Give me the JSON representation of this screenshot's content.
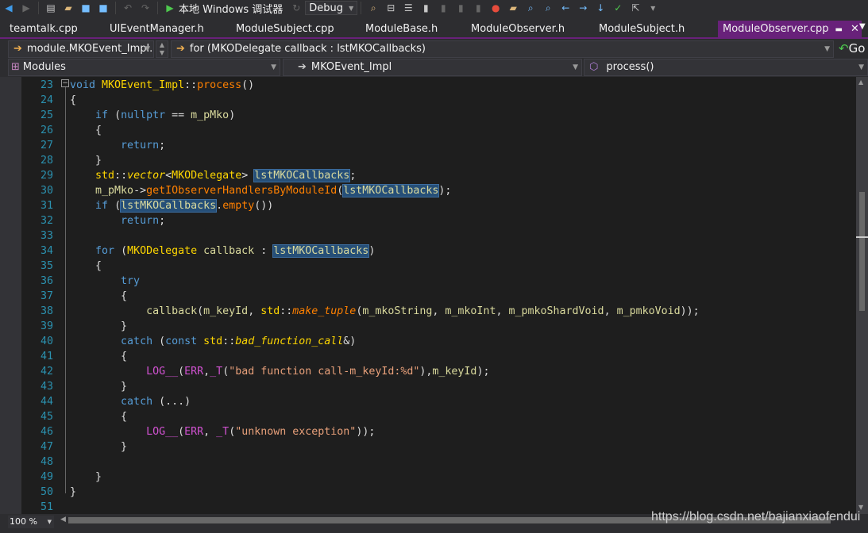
{
  "toolbar": {
    "run_label": "本地 Windows 调试器",
    "config": "Debug"
  },
  "tabs": [
    {
      "label": "teamtalk.cpp"
    },
    {
      "label": "UIEventManager.h"
    },
    {
      "label": "ModuleSubject.cpp"
    },
    {
      "label": "ModuleBase.h"
    },
    {
      "label": "ModuleObserver.h"
    },
    {
      "label": "ModuleSubject.h"
    },
    {
      "label": "ModuleObserver.cpp",
      "active": true
    }
  ],
  "nav": {
    "scope": "module.MKOEvent_Impl.",
    "statement": "for (MKODelegate callback : lstMKOCallbacks)",
    "go": "Go",
    "project": "Modules",
    "class": "MKOEvent_Impl",
    "member": "process()"
  },
  "colors": {
    "accent": "#68217a",
    "keyword": "#569cd6",
    "highlight": "#264f78",
    "line_number": "#2b91af"
  },
  "lines": [
    {
      "n": "23",
      "t": [
        [
          "kw",
          "void "
        ],
        [
          "type",
          "MKOEvent_Impl"
        ],
        [
          "pl",
          "::"
        ],
        [
          "fn",
          "process"
        ],
        [
          "pl",
          "()"
        ]
      ]
    },
    {
      "n": "24",
      "t": [
        [
          "pl",
          "{"
        ]
      ]
    },
    {
      "n": "25",
      "t": [
        [
          "pl",
          "    "
        ],
        [
          "kw",
          "if "
        ],
        [
          "pl",
          "("
        ],
        [
          "kw",
          "nullptr"
        ],
        [
          "pl",
          " == "
        ],
        [
          "mem",
          "m_pMko"
        ],
        [
          "pl",
          ")"
        ]
      ]
    },
    {
      "n": "26",
      "t": [
        [
          "pl",
          "    {"
        ]
      ]
    },
    {
      "n": "27",
      "t": [
        [
          "pl",
          "        "
        ],
        [
          "kw",
          "return"
        ],
        [
          "pl",
          ";"
        ]
      ]
    },
    {
      "n": "28",
      "t": [
        [
          "pl",
          "    }"
        ]
      ]
    },
    {
      "n": "29",
      "t": [
        [
          "pl",
          "    "
        ],
        [
          "type",
          "std"
        ],
        [
          "pl",
          "::"
        ],
        [
          "ty2",
          "vector"
        ],
        [
          "pl",
          "<"
        ],
        [
          "type",
          "MKODelegate"
        ],
        [
          "pl",
          "> "
        ],
        [
          "hl",
          "lstMKOCallbacks"
        ],
        [
          "pl",
          ";"
        ]
      ]
    },
    {
      "n": "30",
      "t": [
        [
          "pl",
          "    "
        ],
        [
          "mem",
          "m_pMko"
        ],
        [
          "pl",
          "->"
        ],
        [
          "fn",
          "getIObserverHandlersByModuleId"
        ],
        [
          "pl",
          "("
        ],
        [
          "hl",
          "lstMKOCallbacks"
        ],
        [
          "pl",
          ");"
        ]
      ]
    },
    {
      "n": "31",
      "t": [
        [
          "pl",
          "    "
        ],
        [
          "kw",
          "if "
        ],
        [
          "pl",
          "("
        ],
        [
          "hl",
          "lstMKOCallbacks"
        ],
        [
          "pl",
          "."
        ],
        [
          "fn",
          "empty"
        ],
        [
          "pl",
          "())"
        ]
      ]
    },
    {
      "n": "32",
      "t": [
        [
          "pl",
          "        "
        ],
        [
          "kw",
          "return"
        ],
        [
          "pl",
          ";"
        ]
      ]
    },
    {
      "n": "33",
      "t": []
    },
    {
      "n": "34",
      "t": [
        [
          "pl",
          "    "
        ],
        [
          "kw",
          "for "
        ],
        [
          "pl",
          "("
        ],
        [
          "type",
          "MKODelegate"
        ],
        [
          "var",
          " callback"
        ],
        [
          "pl",
          " : "
        ],
        [
          "hl",
          "lstMKOCallbacks"
        ],
        [
          "pl",
          ")"
        ]
      ]
    },
    {
      "n": "35",
      "t": [
        [
          "pl",
          "    {"
        ]
      ]
    },
    {
      "n": "36",
      "t": [
        [
          "pl",
          "        "
        ],
        [
          "kw",
          "try"
        ]
      ]
    },
    {
      "n": "37",
      "t": [
        [
          "pl",
          "        {"
        ]
      ]
    },
    {
      "n": "38",
      "t": [
        [
          "pl",
          "            "
        ],
        [
          "var",
          "callback"
        ],
        [
          "pl",
          "("
        ],
        [
          "mem",
          "m_keyId"
        ],
        [
          "pl",
          ", "
        ],
        [
          "type",
          "std"
        ],
        [
          "pl",
          "::"
        ],
        [
          "fni",
          "make_tuple"
        ],
        [
          "pl",
          "("
        ],
        [
          "mem",
          "m_mkoString"
        ],
        [
          "pl",
          ", "
        ],
        [
          "mem",
          "m_mkoInt"
        ],
        [
          "pl",
          ", "
        ],
        [
          "mem",
          "m_pmkoShardVoid"
        ],
        [
          "pl",
          ", "
        ],
        [
          "mem",
          "m_pmkoVoid"
        ],
        [
          "pl",
          "));"
        ]
      ]
    },
    {
      "n": "39",
      "t": [
        [
          "pl",
          "        }"
        ]
      ]
    },
    {
      "n": "40",
      "t": [
        [
          "pl",
          "        "
        ],
        [
          "kw",
          "catch "
        ],
        [
          "pl",
          "("
        ],
        [
          "kw",
          "const "
        ],
        [
          "type",
          "std"
        ],
        [
          "pl",
          "::"
        ],
        [
          "ty2",
          "bad_function_call"
        ],
        [
          "pl",
          "&)"
        ]
      ]
    },
    {
      "n": "41",
      "t": [
        [
          "pl",
          "        {"
        ]
      ]
    },
    {
      "n": "42",
      "t": [
        [
          "pl",
          "            "
        ],
        [
          "mac",
          "LOG__"
        ],
        [
          "pl",
          "("
        ],
        [
          "mac",
          "ERR"
        ],
        [
          "pl",
          ","
        ],
        [
          "mac",
          "_T"
        ],
        [
          "pl",
          "("
        ],
        [
          "str",
          "\"bad function call-m_keyId:%d\""
        ],
        [
          "pl",
          "),"
        ],
        [
          "mem",
          "m_keyId"
        ],
        [
          "pl",
          ");"
        ]
      ]
    },
    {
      "n": "43",
      "t": [
        [
          "pl",
          "        }"
        ]
      ]
    },
    {
      "n": "44",
      "t": [
        [
          "pl",
          "        "
        ],
        [
          "kw",
          "catch "
        ],
        [
          "pl",
          "(...)"
        ]
      ]
    },
    {
      "n": "45",
      "t": [
        [
          "pl",
          "        {"
        ]
      ]
    },
    {
      "n": "46",
      "t": [
        [
          "pl",
          "            "
        ],
        [
          "mac",
          "LOG__"
        ],
        [
          "pl",
          "("
        ],
        [
          "mac",
          "ERR"
        ],
        [
          "pl",
          ", "
        ],
        [
          "mac",
          "_T"
        ],
        [
          "pl",
          "("
        ],
        [
          "str",
          "\"unknown exception\""
        ],
        [
          "pl",
          "));"
        ]
      ]
    },
    {
      "n": "47",
      "t": [
        [
          "pl",
          "        }"
        ]
      ]
    },
    {
      "n": "48",
      "t": []
    },
    {
      "n": "49",
      "t": [
        [
          "pl",
          "    }"
        ]
      ]
    },
    {
      "n": "50",
      "t": [
        [
          "pl",
          "}"
        ]
      ]
    },
    {
      "n": "51",
      "t": []
    }
  ],
  "status": {
    "zoom": "100 %",
    "watermark": "https://blog.csdn.net/bajianxiaofendui"
  }
}
